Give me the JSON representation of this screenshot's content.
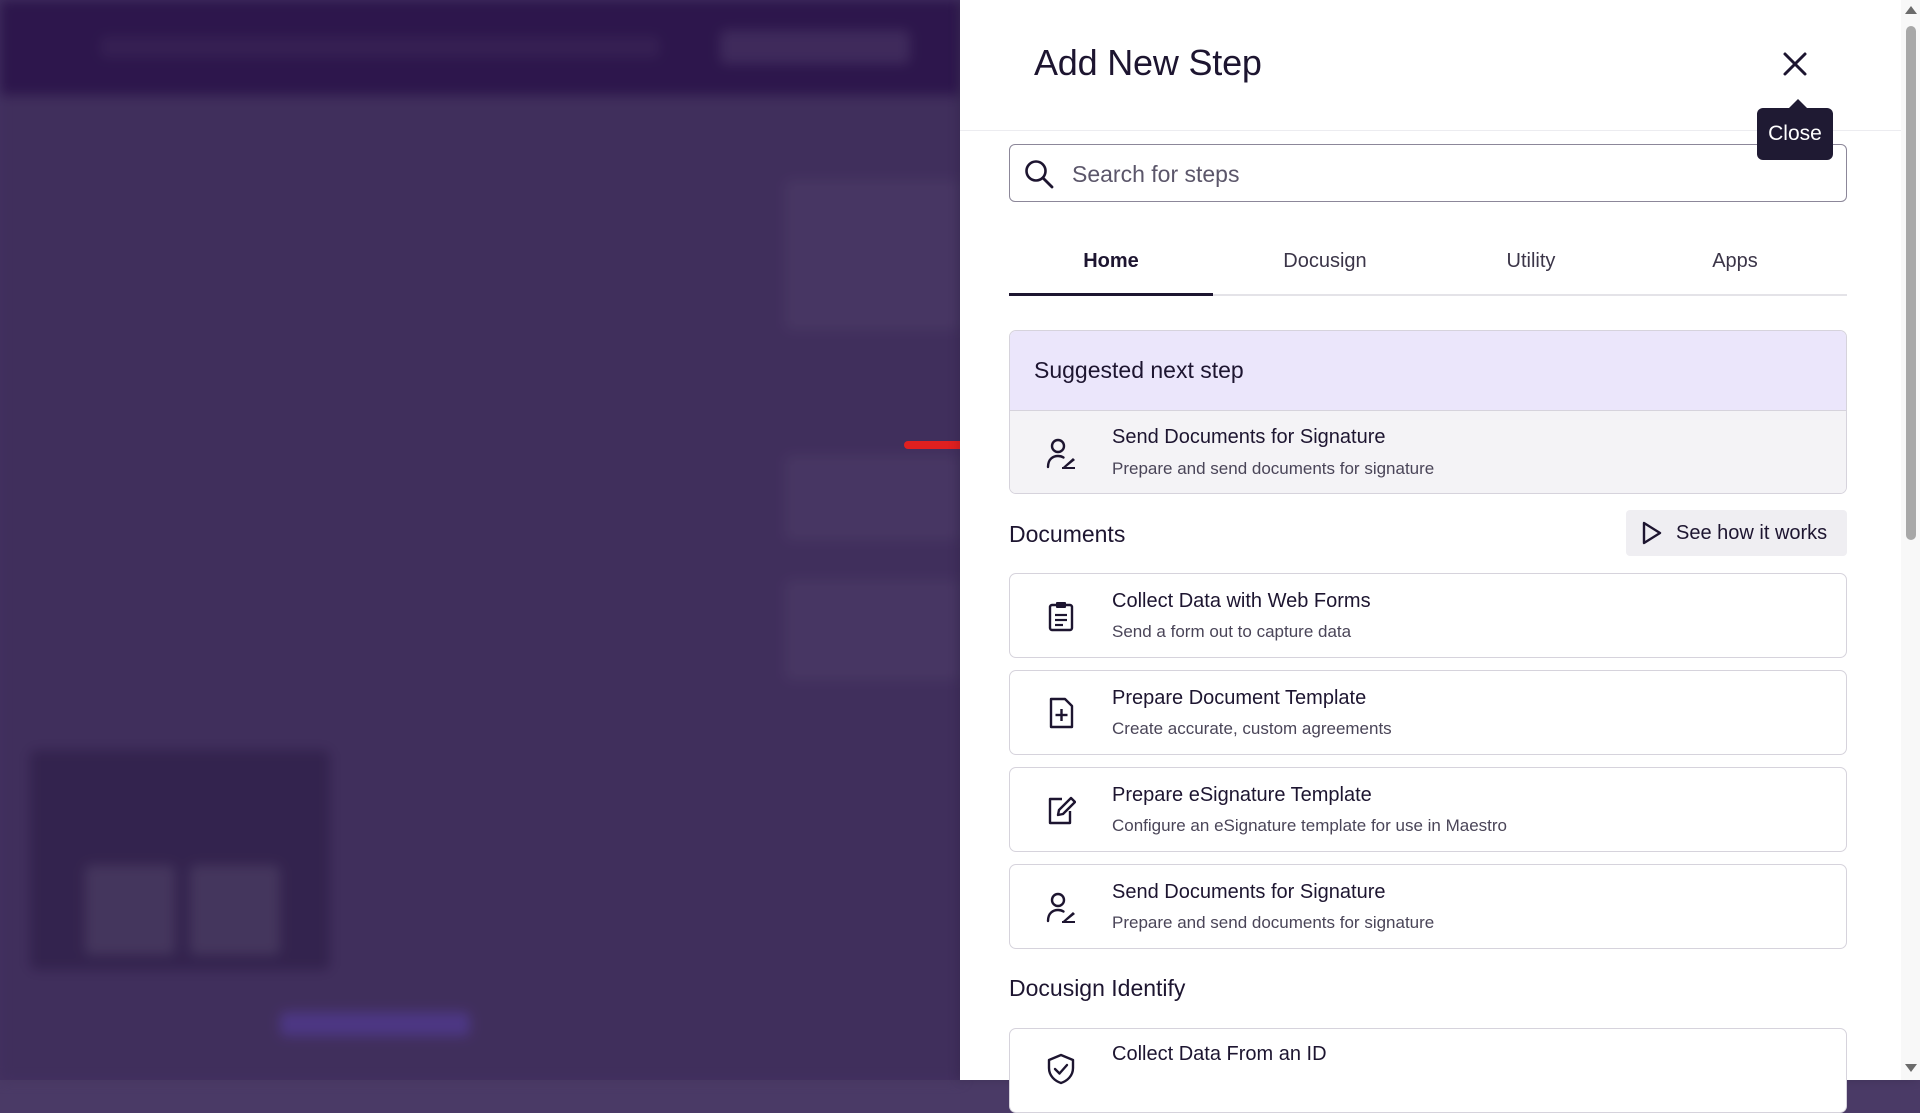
{
  "drawer": {
    "title": "Add New Step",
    "close_tooltip": "Close"
  },
  "search": {
    "placeholder": "Search for steps",
    "value": ""
  },
  "tabs": [
    {
      "label": "Home",
      "active": true
    },
    {
      "label": "Docusign",
      "active": false
    },
    {
      "label": "Utility",
      "active": false
    },
    {
      "label": "Apps",
      "active": false
    }
  ],
  "suggested": {
    "heading": "Suggested next step",
    "item": {
      "title": "Send Documents for Signature",
      "description": "Prepare and send documents for signature",
      "icon": "person-sign-icon"
    }
  },
  "documents_section": {
    "title": "Documents",
    "see_how_label": "See how it works",
    "items": [
      {
        "title": "Collect Data with Web Forms",
        "description": "Send a form out to capture data",
        "icon": "clipboard-icon"
      },
      {
        "title": "Prepare Document Template",
        "description": "Create accurate, custom agreements",
        "icon": "document-plus-icon"
      },
      {
        "title": "Prepare eSignature Template",
        "description": "Configure an eSignature template for use in Maestro",
        "icon": "edit-document-icon"
      },
      {
        "title": "Send Documents for Signature",
        "description": "Prepare and send documents for signature",
        "icon": "person-sign-icon"
      }
    ]
  },
  "identify_section": {
    "title": "Docusign Identify",
    "items": [
      {
        "title": "Collect Data From an ID",
        "description": "",
        "icon": "shield-check-icon"
      }
    ]
  },
  "colors": {
    "overlay": "#46365f",
    "suggest_header": "#ebe6fb",
    "arrow": "#e02020",
    "text": "#1d1530"
  }
}
